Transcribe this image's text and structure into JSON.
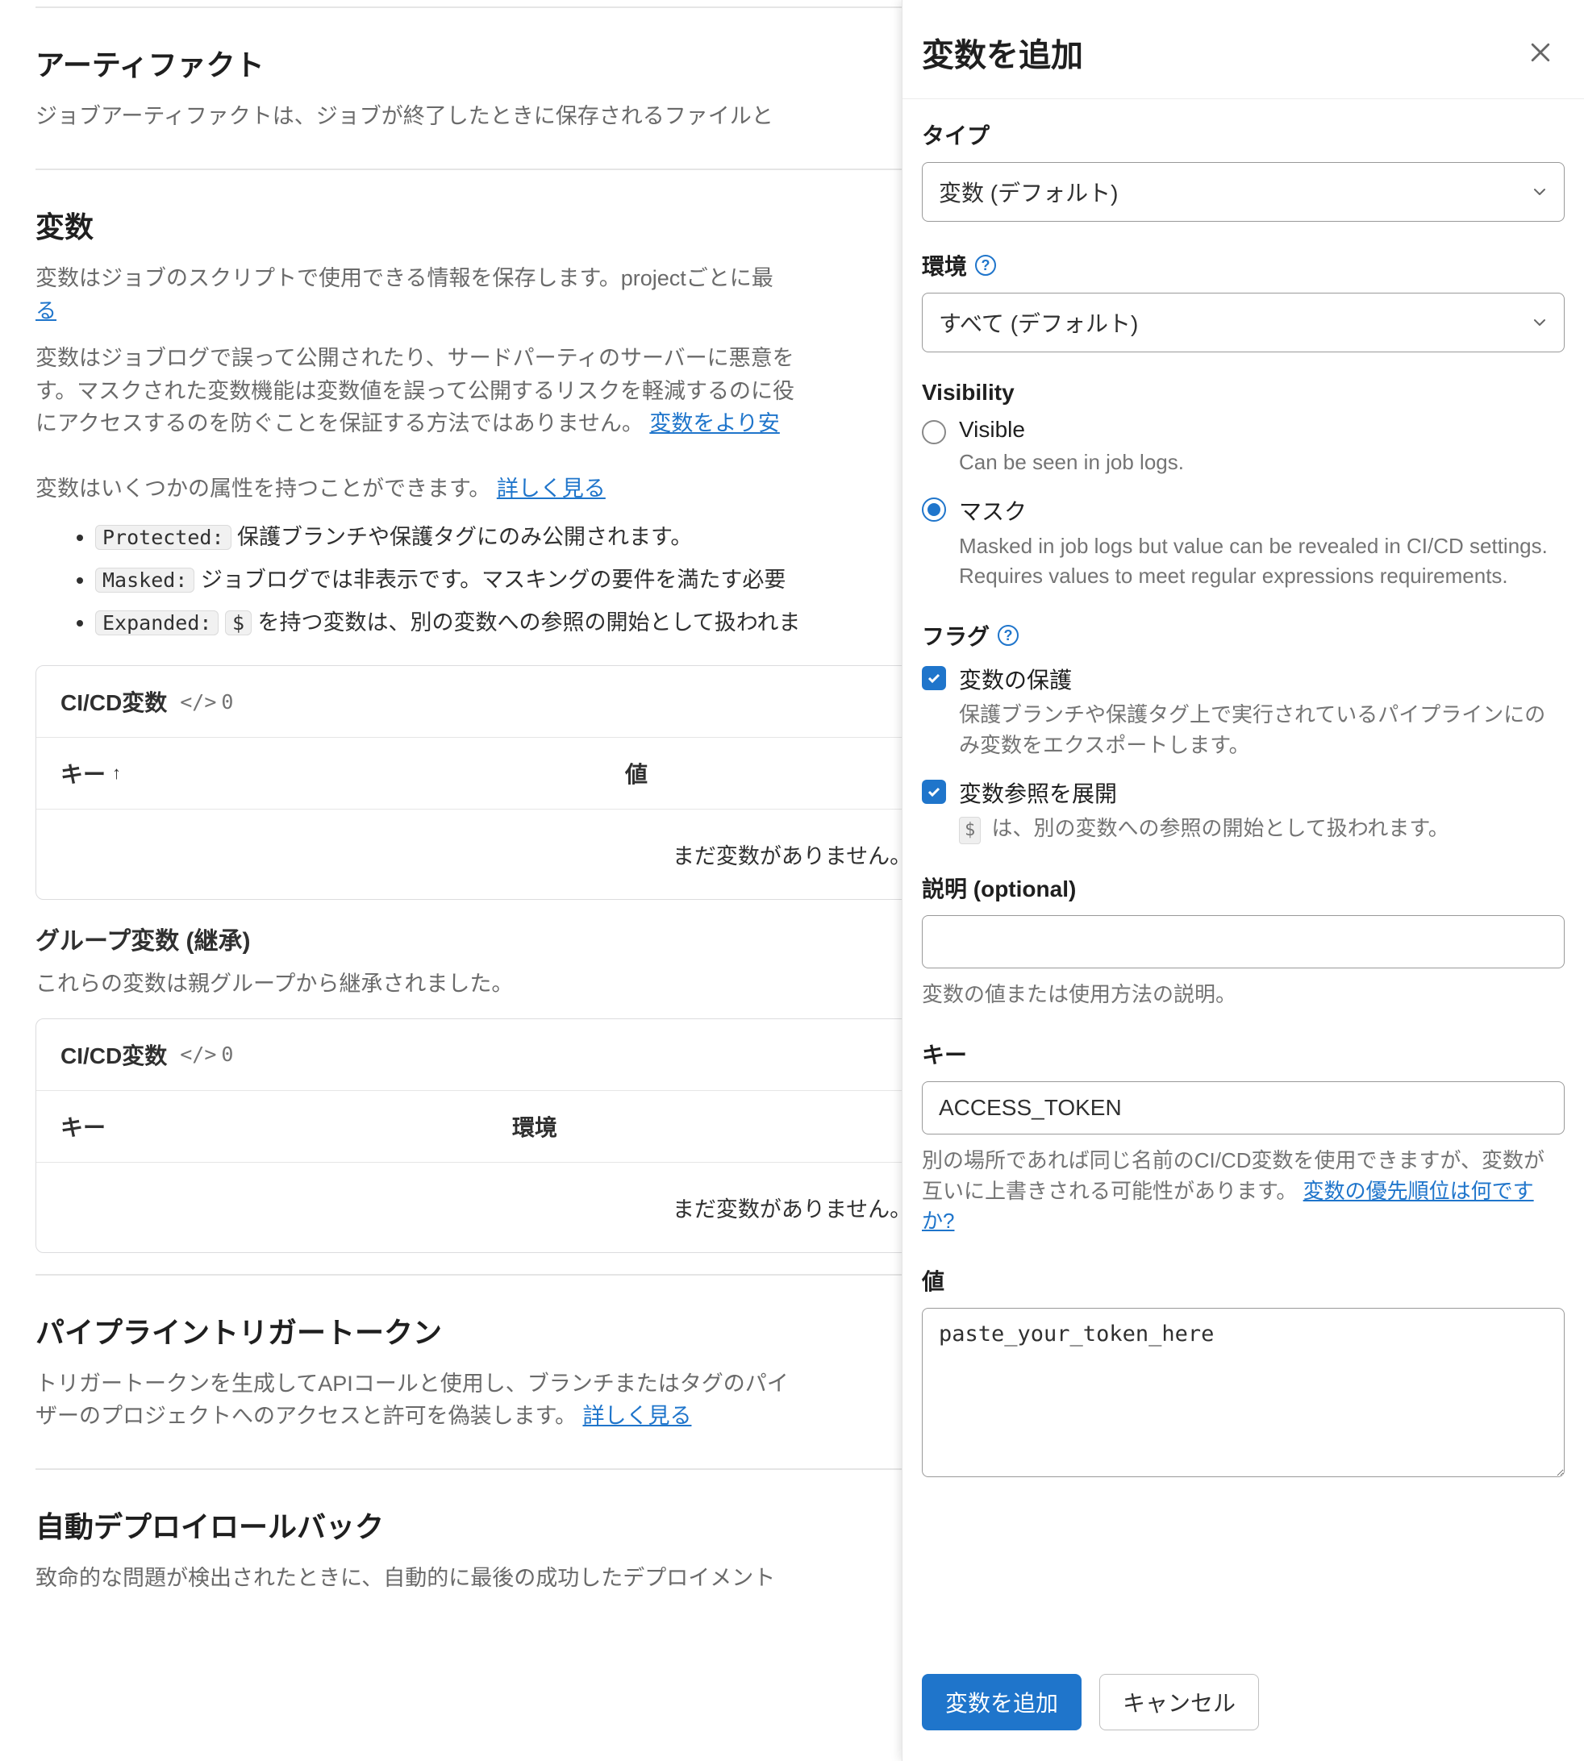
{
  "bg": {
    "artifacts": {
      "title": "アーティファクト",
      "desc_prefix": "ジョブアーティファクトは、ジョブが終了したときに保存されるファイルと"
    },
    "variables": {
      "title": "変数",
      "p1_prefix": "変数はジョブのスクリプトで使用できる情報を保存します。projectごとに最",
      "p1_link_frag": "る",
      "p2_a": "変数はジョブログで誤って公開されたり、サードパーティのサーバーに悪意を",
      "p2_b": "す。マスクされた変数機能は変数値を誤って公開するリスクを軽減するのに役",
      "p2_c": "にアクセスするのを防ぐことを保証する方法ではありません。 ",
      "p2_link": "変数をより安",
      "p3_a": "変数はいくつかの属性を持つことができます。 ",
      "p3_link": "詳しく見る",
      "attrs": {
        "protected_code": "Protected:",
        "protected_text": " 保護ブランチや保護タグにのみ公開されます。",
        "masked_code": "Masked:",
        "masked_text": " ジョブログでは非表示です。マスキングの要件を満たす必要",
        "expanded_code": "Expanded:",
        "expanded_dollar": "$",
        "expanded_text": " を持つ変数は、別の変数への参照の開始として扱われま"
      },
      "card1": {
        "heading": "CI/CD変数",
        "count": "0",
        "col_key": "キー",
        "col_value": "値",
        "empty": "まだ変数がありません。"
      },
      "group_title": "グループ変数 (継承)",
      "group_desc": "これらの変数は親グループから継承されました。",
      "card2": {
        "heading": "CI/CD変数",
        "count": "0",
        "col_key": "キー",
        "col_env": "環境",
        "empty": "まだ変数がありません。"
      }
    },
    "trigger": {
      "title": "パイプライントリガートークン",
      "p1": "トリガートークンを生成してAPIコールと使用し、ブランチまたはタグのパイ",
      "p2_pre": "ザーのプロジェクトへのアクセスと許可を偽装します。 ",
      "p2_link": "詳しく見る"
    },
    "rollback": {
      "title": "自動デプロイロールバック",
      "p1": "致命的な問題が検出されたときに、自動的に最後の成功したデプロイメント"
    }
  },
  "panel": {
    "title": "変数を追加",
    "type": {
      "label": "タイプ",
      "value": "変数 (デフォルト)"
    },
    "env": {
      "label": "環境",
      "value": "すべて (デフォルト)"
    },
    "visibility": {
      "label": "Visibility",
      "visible": {
        "title": "Visible",
        "desc": "Can be seen in job logs."
      },
      "masked": {
        "title": "マスク",
        "desc": "Masked in job logs but value can be revealed in CI/CD settings. Requires values to meet regular expressions requirements."
      }
    },
    "flags": {
      "label": "フラグ",
      "protect": {
        "title": "変数の保護",
        "desc": "保護ブランチや保護タグ上で実行されているパイプラインにのみ変数をエクスポートします。"
      },
      "expand": {
        "title": "変数参照を展開",
        "desc_post": " は、別の変数への参照の開始として扱われます。"
      }
    },
    "description": {
      "label": "説明 (optional)",
      "value": "",
      "help": "変数の値または使用方法の説明。"
    },
    "key": {
      "label": "キー",
      "value": "ACCESS_TOKEN",
      "help_pre": "別の場所であれば同じ名前のCI/CD変数を使用できますが、変数が互いに上書きされる可能性があります。",
      "help_link": "変数の優先順位は何ですか?"
    },
    "value": {
      "label": "値",
      "value": "paste_your_token_here"
    },
    "footer": {
      "submit": "変数を追加",
      "cancel": "キャンセル"
    }
  }
}
